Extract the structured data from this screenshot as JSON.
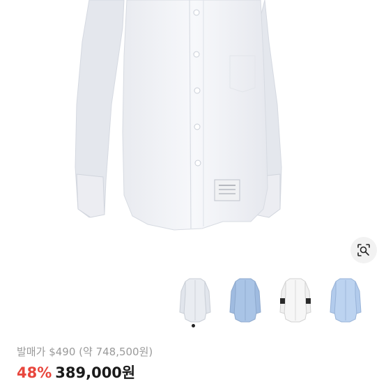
{
  "product": {
    "image_alt": "white oxford shirt",
    "thumbnails": [
      {
        "name": "white-shirt",
        "color": "#eef0f4"
      },
      {
        "name": "blue-shirt",
        "color": "#a9c4e6"
      },
      {
        "name": "white-shirt-stripe",
        "color": "#f4f4f4"
      },
      {
        "name": "light-blue-shirt",
        "color": "#bcd3f0"
      }
    ],
    "active_thumbnail": 0
  },
  "price": {
    "original_label": "발매가",
    "original_usd": "$490",
    "original_krw": "(약 748,500원)",
    "discount": "48%",
    "final": "389,000원"
  },
  "icons": {
    "image_search": "image-search-icon"
  }
}
